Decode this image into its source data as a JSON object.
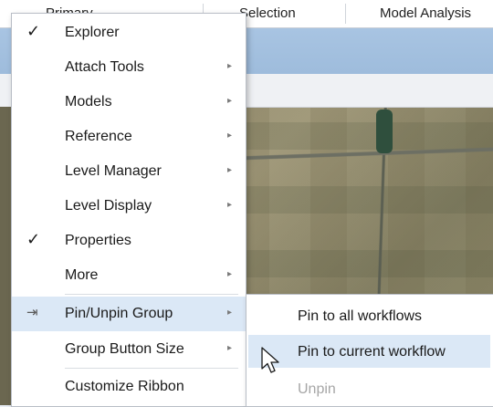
{
  "ribbon": {
    "tabs": [
      {
        "label": "Primary"
      },
      {
        "label": "Selection"
      },
      {
        "label": "Model Analysis"
      }
    ]
  },
  "menu": {
    "items": [
      {
        "label": "Explorer",
        "checked": true,
        "has_submenu": false
      },
      {
        "label": "Attach Tools",
        "checked": false,
        "has_submenu": true
      },
      {
        "label": "Models",
        "checked": false,
        "has_submenu": true
      },
      {
        "label": "Reference",
        "checked": false,
        "has_submenu": true
      },
      {
        "label": "Level Manager",
        "checked": false,
        "has_submenu": true
      },
      {
        "label": "Level Display",
        "checked": false,
        "has_submenu": true
      },
      {
        "label": "Properties",
        "checked": true,
        "has_submenu": false
      },
      {
        "label": "More",
        "checked": false,
        "has_submenu": true
      },
      {
        "label": "Pin/Unpin Group",
        "checked": false,
        "has_submenu": true,
        "icon": "pin-icon",
        "highlighted": true
      },
      {
        "label": "Group Button Size",
        "checked": false,
        "has_submenu": true
      },
      {
        "label": "Customize Ribbon",
        "checked": false,
        "has_submenu": false
      }
    ]
  },
  "submenu": {
    "items": [
      {
        "label": "Pin to all workflows",
        "enabled": true
      },
      {
        "label": "Pin to current workflow",
        "enabled": true,
        "highlighted": true
      },
      {
        "label": "Unpin",
        "enabled": false
      }
    ]
  },
  "colors": {
    "highlight": "#dbe8f6",
    "ribbon_band": "#a8c4e2",
    "disabled_text": "#a6a6a6"
  }
}
